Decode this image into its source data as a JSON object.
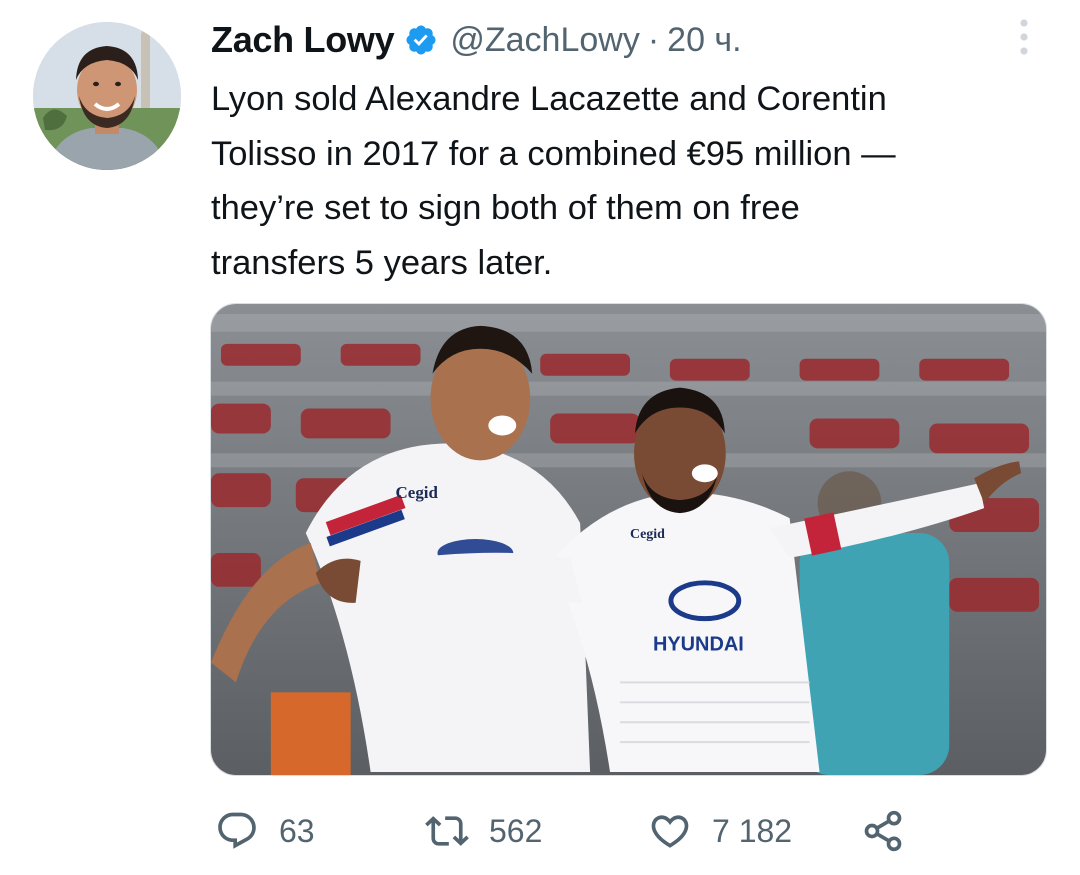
{
  "tweet": {
    "author": {
      "display_name": "Zach Lowy",
      "handle": "@ZachLowy",
      "verified": true,
      "avatar_icon": "avatar-photo"
    },
    "separator": "·",
    "time": "20 ч.",
    "text_lines": [
      "Lyon sold Alexandre Lacazette and Corentin",
      "Tolisso in 2017 for a combined €95 million —",
      "they’re set to sign both of them on free",
      "transfers 5 years later."
    ],
    "media": {
      "icon": "photo-two-lyon-players-celebrating",
      "shirt_text_1": "Cegid",
      "shirt_text_2": "Cegid",
      "shirt_sponsor": "HYUNDAI",
      "shirt_sponsor_display": "HYUNDAI"
    },
    "actions": {
      "reply_count": "63",
      "retweet_count": "562",
      "like_count": "7 182",
      "reply_icon": "reply-icon",
      "retweet_icon": "retweet-icon",
      "like_icon": "heart-icon",
      "share_icon": "share-icon"
    }
  },
  "colors": {
    "text_primary": "#0f1419",
    "text_secondary": "#536471",
    "verified_blue": "#1d9bf0",
    "border": "#d7dde2"
  }
}
